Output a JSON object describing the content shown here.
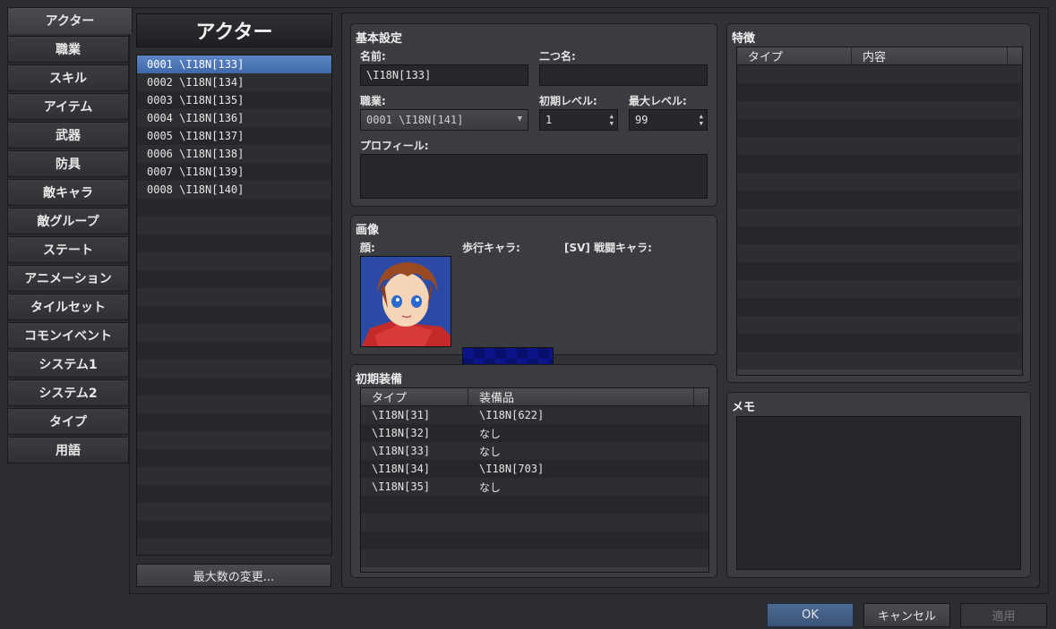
{
  "tabs": [
    {
      "label": "アクター"
    },
    {
      "label": "職業"
    },
    {
      "label": "スキル"
    },
    {
      "label": "アイテム"
    },
    {
      "label": "武器"
    },
    {
      "label": "防具"
    },
    {
      "label": "敵キャラ"
    },
    {
      "label": "敵グループ"
    },
    {
      "label": "ステート"
    },
    {
      "label": "アニメーション"
    },
    {
      "label": "タイルセット"
    },
    {
      "label": "コモンイベント"
    },
    {
      "label": "システム1"
    },
    {
      "label": "システム2"
    },
    {
      "label": "タイプ"
    },
    {
      "label": "用語"
    }
  ],
  "list": {
    "title": "アクター",
    "items": [
      "0001 \\I18N[133]",
      "0002 \\I18N[134]",
      "0003 \\I18N[135]",
      "0004 \\I18N[136]",
      "0005 \\I18N[137]",
      "0006 \\I18N[138]",
      "0007 \\I18N[139]",
      "0008 \\I18N[140]"
    ],
    "max_button": "最大数の変更..."
  },
  "basic": {
    "title": "基本設定",
    "name_label": "名前:",
    "name_value": "\\I18N[133]",
    "nickname_label": "二つ名:",
    "nickname_value": "",
    "class_label": "職業:",
    "class_value": "0001 \\I18N[141]",
    "init_level_label": "初期レベル:",
    "init_level_value": "1",
    "max_level_label": "最大レベル:",
    "max_level_value": "99",
    "profile_label": "プロフィール:",
    "profile_value": ""
  },
  "images": {
    "title": "画像",
    "face_label": "顔:",
    "walk_label": "歩行キャラ:",
    "battle_label": "[SV] 戦闘キャラ:"
  },
  "equipment": {
    "title": "初期装備",
    "col_type": "タイプ",
    "col_item": "装備品",
    "rows": [
      {
        "type": "\\I18N[31]",
        "item": "\\I18N[622]"
      },
      {
        "type": "\\I18N[32]",
        "item": "なし"
      },
      {
        "type": "\\I18N[33]",
        "item": "なし"
      },
      {
        "type": "\\I18N[34]",
        "item": "\\I18N[703]"
      },
      {
        "type": "\\I18N[35]",
        "item": "なし"
      }
    ]
  },
  "traits": {
    "title": "特徴",
    "col_type": "タイプ",
    "col_content": "内容"
  },
  "memo": {
    "title": "メモ"
  },
  "buttons": {
    "ok": "OK",
    "cancel": "キャンセル",
    "apply": "適用"
  },
  "colors": {
    "selection": "#4f78b8",
    "panel": "#3a3c40",
    "background": "#2b2d30"
  }
}
